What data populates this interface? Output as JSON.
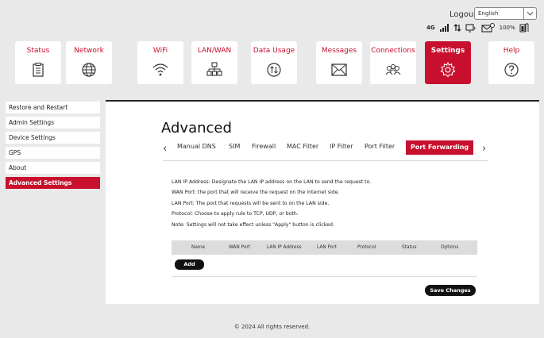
{
  "header": {
    "logout_label": "Logout",
    "language_selected": "English",
    "network_type": "4G",
    "battery_percent": "100%"
  },
  "nav": [
    {
      "label": "Status",
      "icon": "clipboard-icon",
      "active": false
    },
    {
      "label": "Network",
      "icon": "globe-icon",
      "active": false
    },
    {
      "label": "WiFi",
      "icon": "wifi-icon",
      "active": false
    },
    {
      "label": "LAN/WAN",
      "icon": "network-hierarchy-icon",
      "active": false
    },
    {
      "label": "Data Usage",
      "icon": "data-usage-icon",
      "active": false
    },
    {
      "label": "Messages",
      "icon": "envelope-icon",
      "active": false
    },
    {
      "label": "Connections",
      "icon": "people-icon",
      "active": false
    },
    {
      "label": "Settings",
      "icon": "gear-icon",
      "active": true
    },
    {
      "label": "Help",
      "icon": "question-icon",
      "active": false
    }
  ],
  "sidebar": {
    "items": [
      {
        "label": "Restore and Restart"
      },
      {
        "label": "Admin Settings"
      },
      {
        "label": "Device Settings"
      },
      {
        "label": "GPS"
      },
      {
        "label": "About"
      },
      {
        "label": "Advanced Settings"
      }
    ]
  },
  "main": {
    "title": "Advanced",
    "tabs": [
      {
        "label": "Manual DNS"
      },
      {
        "label": "SIM"
      },
      {
        "label": "Firewall"
      },
      {
        "label": "MAC Filter"
      },
      {
        "label": "IP Filter"
      },
      {
        "label": "Port Filter"
      },
      {
        "label": "Port Forwarding"
      }
    ],
    "description": [
      "LAN IP Address: Designate the LAN IP address on the LAN to send the request to.",
      "WAN Port: the port that will receive the request on the internet side.",
      "LAN Port: The port that requests will be sent to on the LAN side.",
      "Protocol: Choose to apply rule to TCP, UDP, or both.",
      "Note: Settings will not take effect unless \"Apply\" button is clicked."
    ],
    "table_headers": [
      "Name",
      "WAN Port",
      "LAN IP Address",
      "LAN Port",
      "Protocol",
      "Status",
      "Options"
    ],
    "add_label": "Add",
    "save_label": "Save Changes"
  },
  "footer": {
    "text": "© 2024 All rights reserved."
  },
  "colors": {
    "accent": "#c8102e",
    "background": "#e9e9e9"
  }
}
